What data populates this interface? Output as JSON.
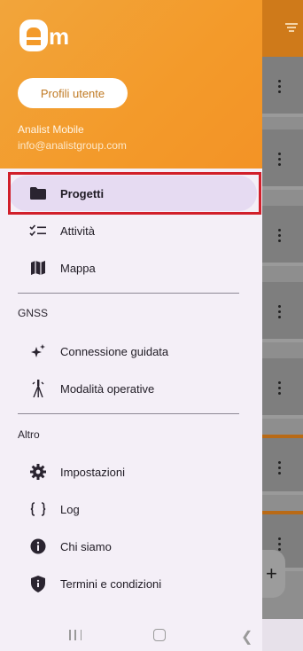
{
  "header": {
    "logo_text": "m",
    "profile_button_label": "Profili utente",
    "user_name": "Analist Mobile",
    "user_email": "info@analistgroup.com"
  },
  "menu": {
    "main_items": [
      {
        "label": "Progetti",
        "icon": "folder-icon",
        "active": true
      },
      {
        "label": "Attività",
        "icon": "checklist-icon",
        "active": false
      },
      {
        "label": "Mappa",
        "icon": "map-icon",
        "active": false
      }
    ],
    "gnss_section_label": "GNSS",
    "gnss_items": [
      {
        "label": "Connessione guidata",
        "icon": "sparkle-icon"
      },
      {
        "label": "Modalità operative",
        "icon": "survey-pole-icon"
      }
    ],
    "other_section_label": "Altro",
    "other_items": [
      {
        "label": "Impostazioni",
        "icon": "gear-icon"
      },
      {
        "label": "Log",
        "icon": "code-braces-icon"
      },
      {
        "label": "Chi siamo",
        "icon": "info-icon"
      },
      {
        "label": "Termini e condizioni",
        "icon": "shield-icon"
      }
    ]
  },
  "background": {
    "fab_symbol": "+"
  },
  "colors": {
    "header_orange": "#f39a2a",
    "active_item_bg": "#e6dbf2",
    "highlight_red": "#d11f2a",
    "drawer_bg": "#f4eff7"
  }
}
